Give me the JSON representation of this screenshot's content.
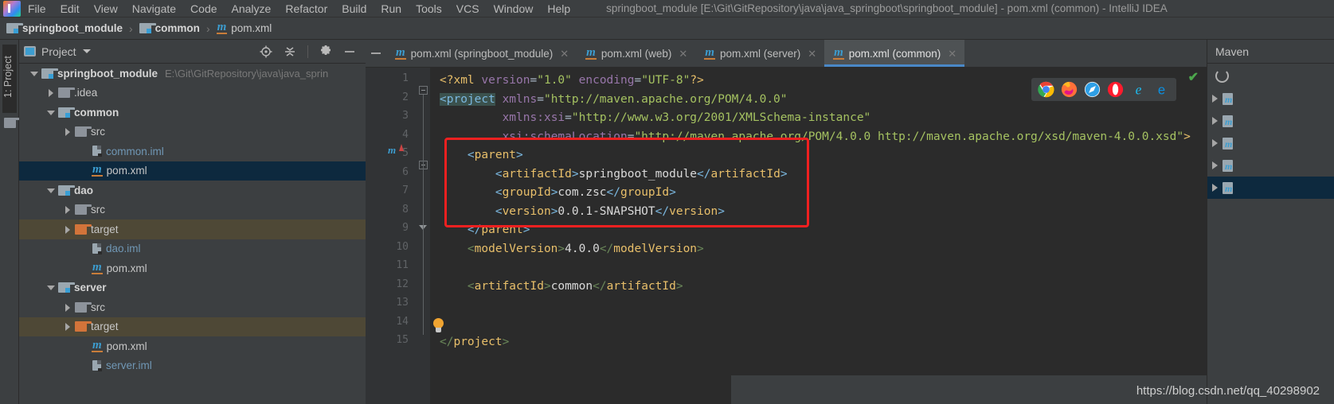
{
  "window": {
    "title": "springboot_module [E:\\Git\\GitRepository\\java\\java_springboot\\springboot_module] - pom.xml (common) - IntelliJ IDEA",
    "logo_name": "intellij-idea-logo"
  },
  "menubar": {
    "items": [
      {
        "label": "File"
      },
      {
        "label": "Edit"
      },
      {
        "label": "View"
      },
      {
        "label": "Navigate"
      },
      {
        "label": "Code"
      },
      {
        "label": "Analyze"
      },
      {
        "label": "Refactor"
      },
      {
        "label": "Build"
      },
      {
        "label": "Run"
      },
      {
        "label": "Tools"
      },
      {
        "label": "VCS"
      },
      {
        "label": "Window"
      },
      {
        "label": "Help"
      }
    ]
  },
  "breadcrumb": {
    "items": [
      {
        "label": "springboot_module",
        "icon": "module-icon",
        "bold": true
      },
      {
        "label": "common",
        "icon": "module-icon",
        "bold": true
      },
      {
        "label": "pom.xml",
        "icon": "maven-m-icon",
        "bold": false
      }
    ],
    "separator": "›"
  },
  "left_strip": {
    "label": "1: Project",
    "folder_icon": "folder-icon"
  },
  "project_panel": {
    "title": "Project",
    "tools": [
      {
        "name": "locate-target-icon"
      },
      {
        "name": "collapse-all-icon"
      },
      {
        "name": "gear-icon"
      },
      {
        "name": "minimize-icon"
      }
    ],
    "tree": [
      {
        "label": "springboot_module",
        "path": "E:\\Git\\GitRepository\\java\\java_sprin",
        "indent": 0,
        "twist": "open",
        "icon": "module-icon",
        "bold": true,
        "state": "normal"
      },
      {
        "label": ".idea",
        "path": "",
        "indent": 1,
        "twist": "closed",
        "icon": "folder-icon",
        "bold": false,
        "state": "normal"
      },
      {
        "label": "common",
        "path": "",
        "indent": 1,
        "twist": "open",
        "icon": "module-icon",
        "bold": true,
        "state": "normal"
      },
      {
        "label": "src",
        "path": "",
        "indent": 2,
        "twist": "closed",
        "icon": "folder-icon",
        "bold": false,
        "state": "normal"
      },
      {
        "label": "common.iml",
        "path": "",
        "indent": 3,
        "twist": "none",
        "icon": "iml-icon",
        "bold": false,
        "state": "normal"
      },
      {
        "label": "pom.xml",
        "path": "",
        "indent": 3,
        "twist": "none",
        "icon": "maven-m-icon",
        "bold": false,
        "state": "selected"
      },
      {
        "label": "dao",
        "path": "",
        "indent": 1,
        "twist": "open",
        "icon": "module-icon",
        "bold": true,
        "state": "normal"
      },
      {
        "label": "src",
        "path": "",
        "indent": 2,
        "twist": "closed",
        "icon": "folder-icon",
        "bold": false,
        "state": "normal"
      },
      {
        "label": "target",
        "path": "",
        "indent": 2,
        "twist": "closed",
        "icon": "folder-orange-icon",
        "bold": false,
        "state": "target"
      },
      {
        "label": "dao.iml",
        "path": "",
        "indent": 3,
        "twist": "none",
        "icon": "iml-icon",
        "bold": false,
        "state": "normal"
      },
      {
        "label": "pom.xml",
        "path": "",
        "indent": 3,
        "twist": "none",
        "icon": "maven-m-icon",
        "bold": false,
        "state": "normal"
      },
      {
        "label": "server",
        "path": "",
        "indent": 1,
        "twist": "open",
        "icon": "module-icon",
        "bold": true,
        "state": "normal"
      },
      {
        "label": "src",
        "path": "",
        "indent": 2,
        "twist": "closed",
        "icon": "folder-icon",
        "bold": false,
        "state": "normal"
      },
      {
        "label": "target",
        "path": "",
        "indent": 2,
        "twist": "closed",
        "icon": "folder-orange-icon",
        "bold": false,
        "state": "target"
      },
      {
        "label": "pom.xml",
        "path": "",
        "indent": 3,
        "twist": "none",
        "icon": "maven-m-icon",
        "bold": false,
        "state": "normal"
      },
      {
        "label": "server.iml",
        "path": "",
        "indent": 3,
        "twist": "none",
        "icon": "iml-icon",
        "bold": false,
        "state": "normal"
      }
    ]
  },
  "editor": {
    "tabs": [
      {
        "label": "pom.xml (springboot_module)",
        "active": false,
        "close": "✕"
      },
      {
        "label": "pom.xml (web)",
        "active": false,
        "close": "✕"
      },
      {
        "label": "pom.xml (server)",
        "active": false,
        "close": "✕"
      },
      {
        "label": "pom.xml (common)",
        "active": true,
        "close": "✕"
      }
    ],
    "line_numbers": [
      "1",
      "2",
      "3",
      "4",
      "5",
      "6",
      "7",
      "8",
      "9",
      "10",
      "11",
      "12",
      "13",
      "14",
      "15"
    ],
    "code_lines": [
      "<?xml version=\"1.0\" encoding=\"UTF-8\"?>",
      "<project xmlns=\"http://maven.apache.org/POM/4.0.0\"",
      "         xmlns:xsi=\"http://www.w3.org/2001/XMLSchema-instance\"",
      "         xsi:schemaLocation=\"http://maven.apache.org/POM/4.0.0 http://maven.apache.org/xsd/maven-4.0.0.xsd\">",
      "    <parent>",
      "        <artifactId>springboot_module</artifactId>",
      "        <groupId>com.zsc</groupId>",
      "        <version>0.0.1-SNAPSHOT</version>",
      "    </parent>",
      "    <modelVersion>4.0.0</modelVersion>",
      "",
      "    <artifactId>common</artifactId>",
      "",
      "",
      "</project>"
    ],
    "annotation": {
      "shape": "red-rectangle",
      "color": "#f02020",
      "covers_lines": "5-9"
    },
    "gutter_markers": [
      {
        "line": 5,
        "name": "maven-parent-marker",
        "glyph": "m"
      }
    ],
    "intention_bulb": {
      "line": 14,
      "name": "intention-bulb-icon"
    },
    "browser_popup": {
      "browsers": [
        {
          "name": "chrome-icon",
          "color": "#4285f4"
        },
        {
          "name": "firefox-icon",
          "color": "#e66000"
        },
        {
          "name": "safari-icon",
          "color": "#4a9fe0"
        },
        {
          "name": "opera-icon",
          "color": "#ff1b2d"
        },
        {
          "name": "internet-explorer-icon",
          "color": "#1ebbee"
        },
        {
          "name": "edge-icon",
          "color": "#0078d7"
        }
      ]
    },
    "inspection_status": {
      "name": "inspections-ok-check",
      "glyph": "✔",
      "color": "#4ca64c"
    }
  },
  "maven_panel": {
    "title": "Maven",
    "refresh_icon": "refresh-icon",
    "rows": [
      {
        "name": "maven-project-row",
        "selected": false
      },
      {
        "name": "maven-project-row",
        "selected": false
      },
      {
        "name": "maven-project-row",
        "selected": false
      },
      {
        "name": "maven-project-row",
        "selected": false
      },
      {
        "name": "maven-project-row",
        "selected": true
      }
    ]
  },
  "watermark": {
    "text": "https://blog.csdn.net/qq_40298902"
  }
}
